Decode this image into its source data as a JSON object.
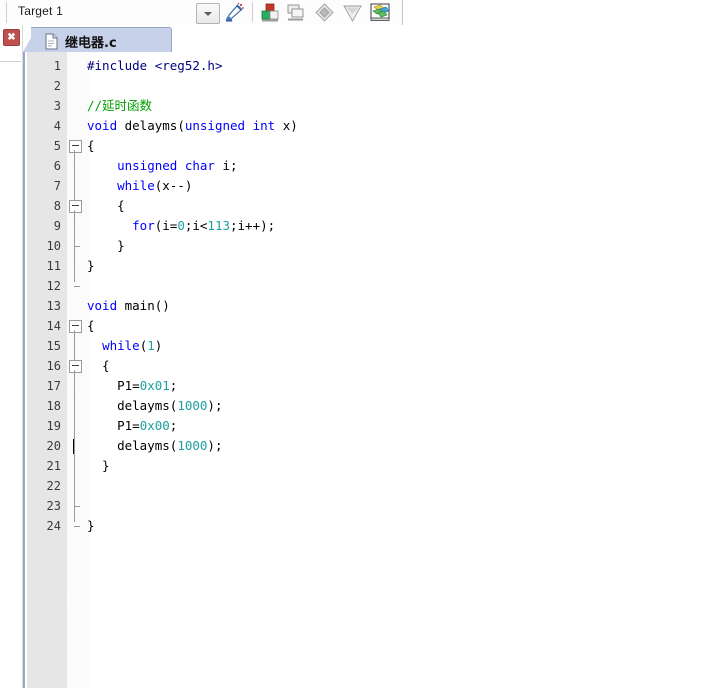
{
  "toolbar": {
    "target_label": "Target 1",
    "dropdown_icon": "chevron-down-icon",
    "icons": [
      {
        "name": "build-wizard-icon",
        "title": "Configuration Wizard"
      },
      {
        "name": "build-target-icon",
        "title": "Build Target"
      },
      {
        "name": "rebuild-all-icon",
        "title": "Rebuild All Target Files"
      },
      {
        "name": "batch-build-icon",
        "title": "Batch Build"
      },
      {
        "name": "translate-file-icon",
        "title": "Translate Current File"
      },
      {
        "name": "target-options-icon",
        "title": "Options for Target"
      }
    ]
  },
  "left_strip": {
    "close_button_label": "✖",
    "close_button_name": "close-window-button"
  },
  "tab": {
    "label": "继电器",
    "extension": ".c",
    "full_label": "继电器.c",
    "icon": "document-icon"
  },
  "editor": {
    "language": "C",
    "caret_line": 20,
    "total_lines": 24,
    "lines": [
      {
        "n": 1,
        "tokens": [
          {
            "t": "#include ",
            "c": "pre"
          },
          {
            "t": "<reg52.h>",
            "c": "pre"
          }
        ]
      },
      {
        "n": 2,
        "tokens": []
      },
      {
        "n": 3,
        "tokens": [
          {
            "t": "//延时函数",
            "c": "cmt"
          }
        ]
      },
      {
        "n": 4,
        "tokens": [
          {
            "t": "void",
            "c": "kw"
          },
          {
            "t": " delayms(",
            "c": ""
          },
          {
            "t": "unsigned",
            "c": "kw"
          },
          {
            "t": " ",
            "c": ""
          },
          {
            "t": "int",
            "c": "kw"
          },
          {
            "t": " x)",
            "c": ""
          }
        ]
      },
      {
        "n": 5,
        "tokens": [
          {
            "t": "{",
            "c": ""
          }
        ]
      },
      {
        "n": 6,
        "tokens": [
          {
            "t": "    ",
            "c": ""
          },
          {
            "t": "unsigned",
            "c": "kw"
          },
          {
            "t": " ",
            "c": ""
          },
          {
            "t": "char",
            "c": "kw"
          },
          {
            "t": " i;",
            "c": ""
          }
        ]
      },
      {
        "n": 7,
        "tokens": [
          {
            "t": "    ",
            "c": ""
          },
          {
            "t": "while",
            "c": "kw"
          },
          {
            "t": "(x--)",
            "c": ""
          }
        ]
      },
      {
        "n": 8,
        "tokens": [
          {
            "t": "    {",
            "c": ""
          }
        ]
      },
      {
        "n": 9,
        "tokens": [
          {
            "t": "      ",
            "c": ""
          },
          {
            "t": "for",
            "c": "kw"
          },
          {
            "t": "(i=",
            "c": ""
          },
          {
            "t": "0",
            "c": "num"
          },
          {
            "t": ";i<",
            "c": ""
          },
          {
            "t": "113",
            "c": "num"
          },
          {
            "t": ";i++);",
            "c": ""
          }
        ]
      },
      {
        "n": 10,
        "tokens": [
          {
            "t": "    }",
            "c": ""
          }
        ]
      },
      {
        "n": 11,
        "tokens": [
          {
            "t": "}",
            "c": ""
          }
        ]
      },
      {
        "n": 12,
        "tokens": []
      },
      {
        "n": 13,
        "tokens": [
          {
            "t": "void",
            "c": "kw"
          },
          {
            "t": " main()",
            "c": ""
          }
        ]
      },
      {
        "n": 14,
        "tokens": [
          {
            "t": "{",
            "c": ""
          }
        ]
      },
      {
        "n": 15,
        "tokens": [
          {
            "t": "  ",
            "c": ""
          },
          {
            "t": "while",
            "c": "kw"
          },
          {
            "t": "(",
            "c": ""
          },
          {
            "t": "1",
            "c": "num"
          },
          {
            "t": ")",
            "c": ""
          }
        ]
      },
      {
        "n": 16,
        "tokens": [
          {
            "t": "  {",
            "c": ""
          }
        ]
      },
      {
        "n": 17,
        "tokens": [
          {
            "t": "    P1=",
            "c": ""
          },
          {
            "t": "0x01",
            "c": "num"
          },
          {
            "t": ";",
            "c": ""
          }
        ]
      },
      {
        "n": 18,
        "tokens": [
          {
            "t": "    delayms(",
            "c": ""
          },
          {
            "t": "1000",
            "c": "num"
          },
          {
            "t": ");",
            "c": ""
          }
        ]
      },
      {
        "n": 19,
        "tokens": [
          {
            "t": "    P1=",
            "c": ""
          },
          {
            "t": "0x00",
            "c": "num"
          },
          {
            "t": ";",
            "c": ""
          }
        ]
      },
      {
        "n": 20,
        "tokens": [
          {
            "t": "    delayms(",
            "c": ""
          },
          {
            "t": "1000",
            "c": "num"
          },
          {
            "t": ");",
            "c": ""
          }
        ]
      },
      {
        "n": 21,
        "tokens": [
          {
            "t": "  }",
            "c": ""
          }
        ]
      },
      {
        "n": 22,
        "tokens": []
      },
      {
        "n": 23,
        "tokens": []
      },
      {
        "n": 24,
        "tokens": [
          {
            "t": "}",
            "c": ""
          }
        ]
      }
    ],
    "fold_boxes": [
      5,
      8,
      14,
      16
    ],
    "colors": {
      "keyword": "#0000ff",
      "preprocessor": "#000080",
      "comment": "#00a000",
      "number": "#1da1a1",
      "text": "#000000",
      "gutter_bg": "#e6e6e6",
      "editor_bg": "#ffffff",
      "tab_bg": "#c8d1ea"
    }
  }
}
